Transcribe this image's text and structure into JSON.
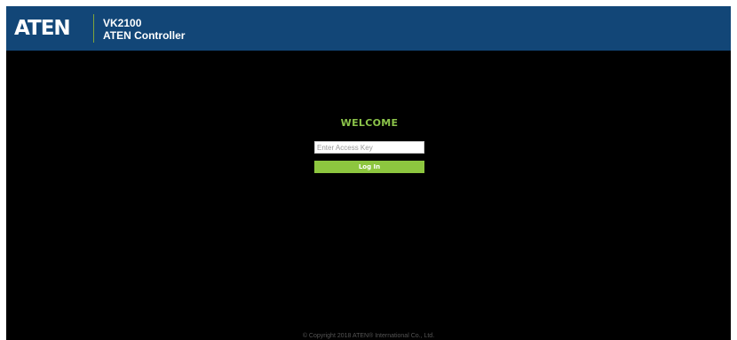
{
  "header": {
    "logo_text": "ATEN",
    "product_model": "VK2100",
    "product_name": "ATEN Controller",
    "background_color": "#124677",
    "logo_divider_color": "#7fa33a"
  },
  "login": {
    "welcome_text": "WELCOME",
    "access_key_placeholder": "Enter Access Key",
    "access_key_value": "",
    "login_button_label": "Log In",
    "accent_color": "#8dc63f"
  },
  "footer": {
    "copyright": "© Copyright 2018 ATEN® International Co., Ltd."
  }
}
